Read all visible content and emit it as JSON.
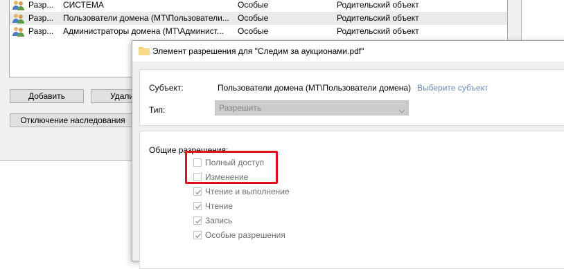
{
  "background_window": {
    "entries": [
      {
        "type": "Разр...",
        "subject": "СИСТЕМА",
        "access": "Особые",
        "inherited": "Родительский объект"
      },
      {
        "type": "Разр...",
        "subject": "Пользователи домена (MT\\Пользователи...",
        "access": "Особые",
        "inherited": "Родительский объект"
      },
      {
        "type": "Разр...",
        "subject": "Администраторы домена (MT\\Админист...",
        "access": "Особые",
        "inherited": "Родительский объект"
      }
    ],
    "add_button": "Добавить",
    "delete_button": "Удали",
    "disable_inheritance_button": "Отключение наследования"
  },
  "dialog": {
    "title": "Элемент разрешения для \"Следим за аукционами.pdf\"",
    "subject_label": "Субъект:",
    "subject_value": "Пользователи домена (MT\\Пользователи домена)",
    "select_subject_link": "Выберите субъект",
    "type_label": "Тип:",
    "type_value": "Разрешить",
    "permissions_heading": "Общие разрешения:",
    "permissions": [
      {
        "label": "Полный доступ",
        "checked": false
      },
      {
        "label": "Изменение",
        "checked": false
      },
      {
        "label": "Чтение и выполнение",
        "checked": true
      },
      {
        "label": "Чтение",
        "checked": true
      },
      {
        "label": "Запись",
        "checked": true
      },
      {
        "label": "Особые разрешения",
        "checked": true
      }
    ]
  },
  "colors": {
    "highlight": "#d9121b",
    "link": "#6d8dbb",
    "selected_row": "#eaeaea"
  }
}
